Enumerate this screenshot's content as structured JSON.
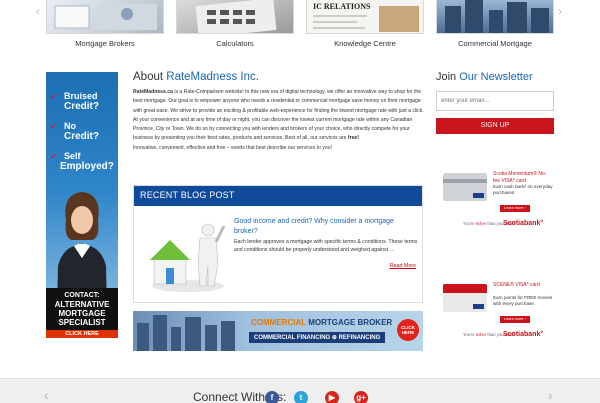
{
  "tiles": [
    {
      "label": "Mortgage Brokers"
    },
    {
      "label": "Calculators"
    },
    {
      "label": "Knowledge Centre",
      "thumb_text": "IC RELATIONS"
    },
    {
      "label": "Commercial Mortgage"
    }
  ],
  "left_banner": {
    "lines": [
      "Bruised",
      "Credit?",
      "No",
      "Credit?",
      "Self",
      "Employed?"
    ],
    "contact": [
      "CONTACT:",
      "ALTERNATIVE",
      "MORTGAGE",
      "SPECIALIST"
    ],
    "click": "CLICK HERE"
  },
  "about": {
    "title_prefix": "About",
    "title_highlight": "RateMadness Inc.",
    "brand": "RateMadness.ca",
    "body": " is a Rate-Comparison website! In this new era of digital technology, we offer an innovative way to shop for the best mortgage. Our goal is to empower anyone who needs a residential or commercial mortgage save money on their mortgage with great ease. We strive to provide an exciting & profitable web-experience for finding the lowest mortgage rate with just a click. At your convenience and at any time of day or night, you can discover the lowest current mortgage rate within any Canadian Province, City or Town. We do so by connecting you with lenders and brokers of your choice, who directly compete for your business by presenting you their best rates, products and services. Best of all, our services are ",
    "free": "free!",
    "tagline": "Innovative, convenient, effective and free – words that best describe our services to you!"
  },
  "blog": {
    "header": "RECENT BLOG POST",
    "title": "Good income and credit? Why consider a mortgage broker?",
    "excerpt": "Each lender approves a mortgage with specific terms & conditions. These terms and conditions should be properly understood and weighed against …",
    "read_more": "Read More"
  },
  "commercial_banner": {
    "title_a": "COMMERCIAL",
    "title_b": " MORTGAGE BROKER",
    "sub": "COMMERCIAL FINANCING ⊕ REFINANCING",
    "click": "CLICK HERE"
  },
  "newsletter": {
    "title_prefix": "Join",
    "title_highlight": "Our Newsletter",
    "placeholder": "enter your email...",
    "button": "SIGN UP"
  },
  "ads": [
    {
      "title": "Scotia Momentum® No-fee VISA* card",
      "desc": "Earn cash back² on everyday purchases.",
      "learn": "Learn more ›",
      "richer_a": "You're ",
      "richer_b": "richer",
      "richer_c": " than you think!",
      "brand": "Scotiabank°"
    },
    {
      "title": "SCENE® VISA* card",
      "desc": "Earn points for FREE movies with every purchase.",
      "learn": "Learn more ›",
      "richer_a": "You're ",
      "richer_b": "richer",
      "richer_c": " than you think!",
      "brand": "Scotiabank°"
    }
  ],
  "footer": {
    "label": "Connect With Us:",
    "social": [
      "f",
      "t",
      "▶",
      "g+"
    ]
  },
  "colors": {
    "accent_blue": "#1a66b3",
    "blog_bar": "#0f4a9b",
    "signup_red": "#c8141a"
  }
}
